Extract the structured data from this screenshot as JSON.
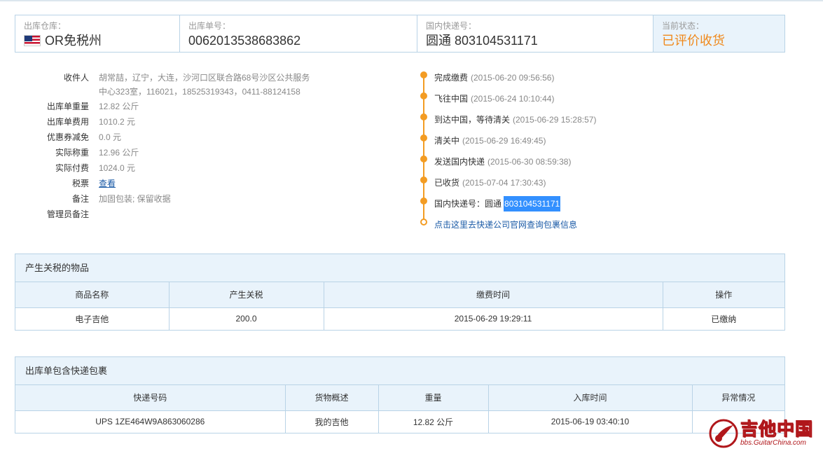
{
  "header": {
    "warehouse_label": "出库仓库：",
    "warehouse_value": "OR免税州",
    "order_label": "出库单号：",
    "order_value": "0062013538683862",
    "express_label": "国内快递号：",
    "express_value": "圆通 803104531171",
    "status_label": "当前状态：",
    "status_value": "已评价收货"
  },
  "details": [
    {
      "key": "收件人",
      "value": "胡常喆，辽宁，大连，沙河口区联合路68号沙区公共服务",
      "value2": "中心323室，116021，18525319343，0411-88124158"
    },
    {
      "key": "出库单重量",
      "value": "12.82 公斤"
    },
    {
      "key": "出库单费用",
      "value": "1010.2 元"
    },
    {
      "key": "优惠券减免",
      "value": "0.0 元"
    },
    {
      "key": "实际称重",
      "value": "12.96 公斤"
    },
    {
      "key": "实际付费",
      "value": "1024.0 元"
    },
    {
      "key": "税票",
      "value": "查看"
    },
    {
      "key": "备注",
      "value": "加固包装; 保留收据"
    },
    {
      "key": "管理员备注",
      "value": ""
    }
  ],
  "timeline": [
    {
      "label": "完成缴费",
      "time": "(2015-06-20 09:56:56)"
    },
    {
      "label": "飞往中国",
      "time": "(2015-06-24 10:10:44)"
    },
    {
      "label": "到达中国，等待清关",
      "time": "(2015-06-29 15:28:57)"
    },
    {
      "label": "清关中",
      "time": "(2015-06-29 16:49:45)"
    },
    {
      "label": "发送国内快递",
      "time": "(2015-06-30 08:59:38)"
    },
    {
      "label": "已收货",
      "time": "(2015-07-04 17:30:43)"
    },
    {
      "label": "国内快递号：圆通",
      "tracking": "803104531171"
    },
    {
      "link": "点击这里去快递公司官网查询包裹信息"
    }
  ],
  "tax_panel": {
    "title": "产生关税的物品",
    "headers": [
      "商品名称",
      "产生关税",
      "缴费时间",
      "操作"
    ],
    "rows": [
      [
        "电子吉他",
        "200.0",
        "2015-06-29 19:29:11",
        "已缴纳"
      ]
    ]
  },
  "parcel_panel": {
    "title": "出库单包含快递包裹",
    "headers": [
      "快递号码",
      "货物概述",
      "重量",
      "入库时间",
      "异常情况"
    ],
    "rows": [
      [
        "UPS 1ZE464W9A863060286",
        "我的吉他",
        "12.82 公斤",
        "2015-06-19 03:40:10",
        ""
      ]
    ]
  },
  "watermark": {
    "title": "吉他中国",
    "url": "bbs.GuitarChina.com"
  },
  "colors": {
    "accent": "#f39c23",
    "border": "#b9d3e6",
    "header_bg": "#e9f3fb",
    "link": "#1a5aa6",
    "status": "#f0881a"
  }
}
